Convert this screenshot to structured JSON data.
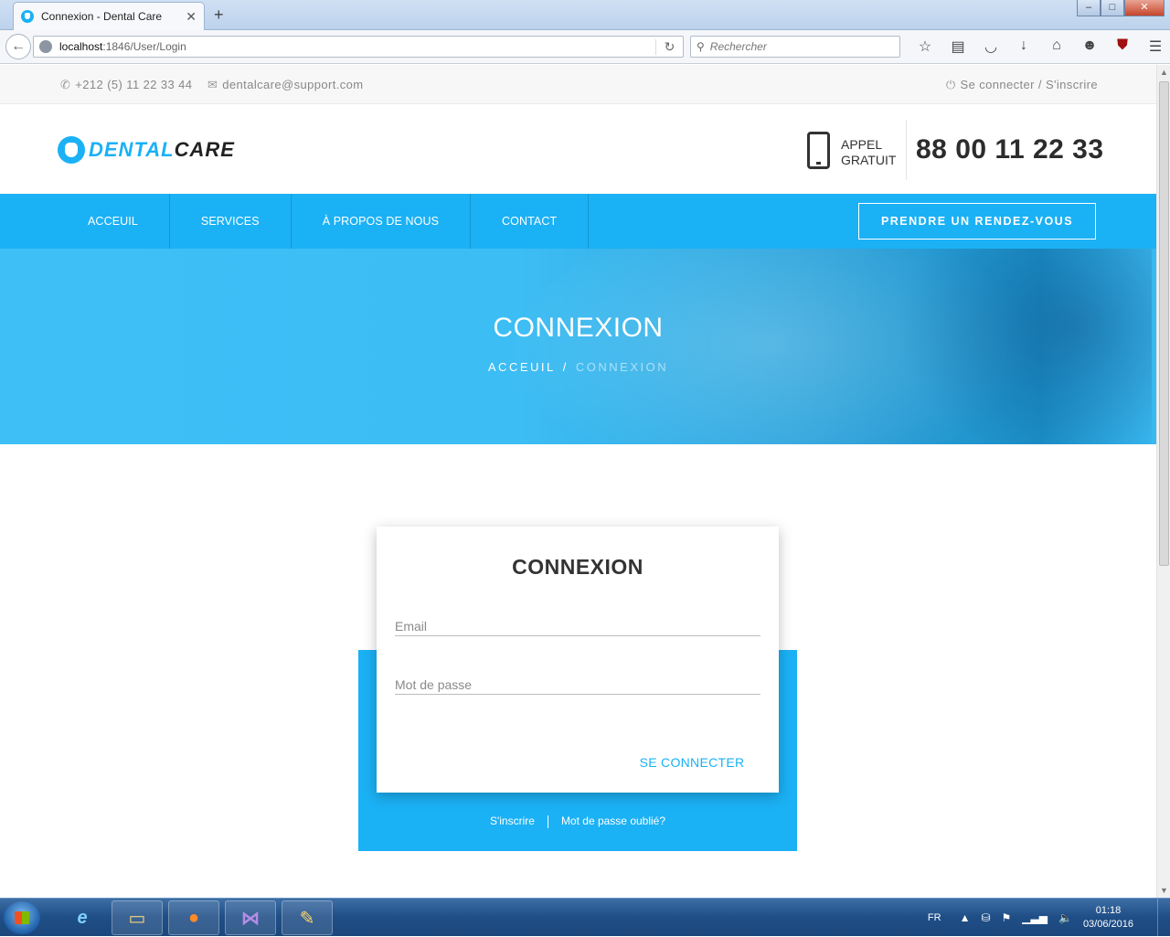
{
  "browser": {
    "tab_title": "Connexion - Dental Care",
    "tab_close": "✕",
    "new_tab": "+",
    "url_host": "localhost",
    "url_path": ":1846/User/Login",
    "search_placeholder": "Rechercher"
  },
  "topbar": {
    "phone": "+212 (5) 11 22 33 44",
    "email": "dentalcare@support.com",
    "login": "Se connecter / S'inscrire"
  },
  "header": {
    "logo_part1": "DENTAL",
    "logo_part2": "CARE",
    "appel_line1": "APPEL",
    "appel_line2": "GRATUIT",
    "phone_big": "88 00 11 22 33"
  },
  "nav": {
    "items": [
      "ACCEUIL",
      "SERVICES",
      "À PROPOS DE NOUS",
      "CONTACT"
    ],
    "cta": "PRENDRE UN RENDEZ-VOUS"
  },
  "hero": {
    "title": "CONNEXION",
    "breadcrumb_home": "ACCEUIL",
    "breadcrumb_sep": "/",
    "breadcrumb_current": "CONNEXION"
  },
  "login": {
    "title": "CONNEXION",
    "email_placeholder": "Email",
    "password_placeholder": "Mot de passe",
    "submit": "SE CONNECTER",
    "register_link": "S'inscrire",
    "forgot_link": "Mot de passe oublié?"
  },
  "taskbar": {
    "lang": "FR",
    "time": "01:18",
    "date": "03/06/2016"
  },
  "colors": {
    "brand": "#1bb1f5",
    "dark_text": "#333333"
  }
}
